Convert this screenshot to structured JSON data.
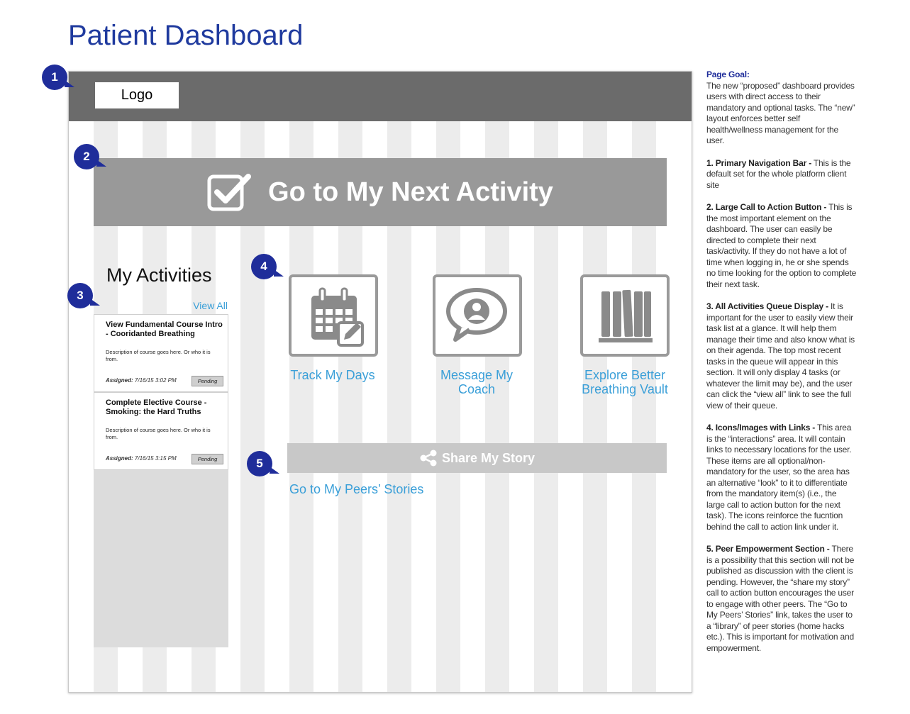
{
  "page_title": "Patient Dashboard",
  "nav": {
    "logo": "Logo"
  },
  "cta": {
    "label": "Go to My Next Activity",
    "icon": "checkbox-icon"
  },
  "activities": {
    "title": "My Activities",
    "view_all": "View All",
    "tasks": [
      {
        "title": "View Fundamental Course Intro - Cooridanted Breathing",
        "description": "Description of course goes here. Or who it is from.",
        "assigned_label": "Assigned:",
        "assigned_date": "7/16/15 3:02 PM",
        "status": "Pending"
      },
      {
        "title": "Complete Elective Course - Smoking: the Hard Truths",
        "description": "Description of course goes here. Or who it is from.",
        "assigned_label": "Assigned:",
        "assigned_date": "7/16/15 3:15 PM",
        "status": "Pending"
      }
    ]
  },
  "links": [
    {
      "label": "Track My Days",
      "icon": "calendar-edit-icon"
    },
    {
      "label": "Message My Coach",
      "icon": "chat-coach-icon"
    },
    {
      "label": "Explore Better Breathing Vault",
      "icon": "books-icon"
    }
  ],
  "share": {
    "label": "Share My Story",
    "icon": "share-icon",
    "peers_link": "Go to My Peers’ Stories"
  },
  "annotations": [
    "1",
    "2",
    "3",
    "4",
    "5"
  ],
  "notes": {
    "goal_heading": "Page Goal:",
    "goal_text": "The new “proposed” dashboard provides users with direct access to their mandatory and optional tasks. The “new” layout enforces better self health/wellness management for the user.",
    "items": [
      {
        "heading": "1. Primary Navigation Bar -",
        "text": " This is the default set for the whole platform client site"
      },
      {
        "heading": "2. Large Call to Action Button -",
        "text": " This is the most important element on the dashboard. The user can easily be directed to complete their next task/activity. If they do not have a lot of time when logging in, he or she spends no time looking for the option to complete their next task."
      },
      {
        "heading": "3. All Activities Queue Display -",
        "text": " It is important for the user to easily view their task list at a glance. It will help them manage their time and also know what is on their agenda. The top most recent tasks in the queue will appear in this section. It will only display 4 tasks (or whatever the limit may be), and the user can click the “view all” link to see the full view of their queue."
      },
      {
        "heading": "4. Icons/Images with Links -",
        "text": " This area is the “interactions” area. It will contain links to necessary locations for the user. These items are all optional/non-mandatory for the user, so the area has an alternative “look” to it to differentiate from the mandatory item(s) (i.e., the large call to action button for the next task). The icons reinforce the fucntion behind the call to action link under it."
      },
      {
        "heading": "5. Peer Empowerment Section -",
        "text": " There is a possibility that this section will not be published as discussion with the client is pending. However, the “share my story” call to action button encourages the user to engage with other peers. The “Go to My Peers’ Stories” link, takes the user to a “library” of peer stories (home hacks etc.). This is important for motivation and empowerment."
      }
    ]
  }
}
